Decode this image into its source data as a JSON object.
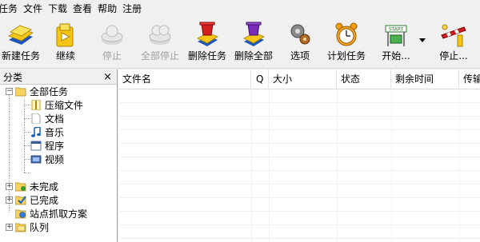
{
  "menu": [
    "任务",
    "文件",
    "下载",
    "查看",
    "帮助",
    "注册"
  ],
  "toolbar": {
    "new_task": "新建任务",
    "resume": "继续",
    "stop": "停止",
    "stop_all": "全部停止",
    "delete_task": "删除任务",
    "delete_all": "删除全部",
    "options": "选项",
    "scheduler": "计划任务",
    "start_queue": "开始...",
    "stop_queue": "停止...",
    "start_sign_text": "START"
  },
  "sidebar": {
    "title": "分类",
    "close": "×",
    "tree": {
      "all_tasks": "全部任务",
      "compressed": "压缩文件",
      "documents": "文档",
      "music": "音乐",
      "programs": "程序",
      "video": "视频",
      "unfinished": "未完成",
      "finished": "已完成",
      "site_grabber": "站点抓取方案",
      "queues": "队列"
    }
  },
  "list": {
    "columns": {
      "filename": "文件名",
      "q": "Q",
      "size": "大小",
      "status": "状态",
      "time_left": "剩余时间",
      "transfer": "传输"
    }
  },
  "colors": {
    "accent_yellow": "#f5c518",
    "folder_yellow": "#f7d25c",
    "check_green": "#2e9e2e",
    "music_blue": "#1b5fc1"
  }
}
